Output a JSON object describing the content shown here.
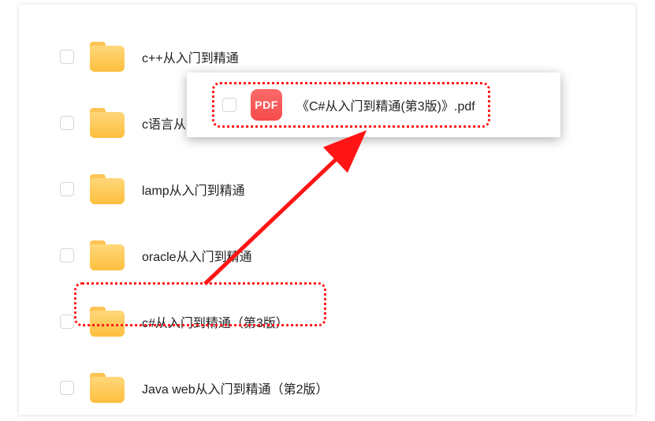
{
  "files": [
    {
      "label": "c++从入门到精通"
    },
    {
      "label": "c语言从"
    },
    {
      "label": "lamp从入门到精通"
    },
    {
      "label": "oracle从入门到精通"
    },
    {
      "label": "c#从入门到精通（第3版）"
    },
    {
      "label": "Java web从入门到精通（第2版）"
    }
  ],
  "popup": {
    "pdf_badge": "PDF",
    "filename": "《C#从入门到精通(第3版)》.pdf"
  }
}
